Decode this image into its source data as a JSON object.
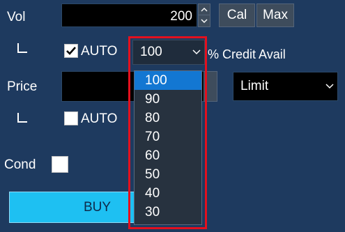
{
  "vol": {
    "label": "Vol",
    "value": "200",
    "cal_label": "Cal",
    "max_label": "Max",
    "auto_label": "AUTO",
    "auto_checked": true
  },
  "credit": {
    "selected": "100",
    "suffix_label": "% Credit Avail",
    "options": [
      "100",
      "90",
      "80",
      "70",
      "60",
      "50",
      "40",
      "30"
    ],
    "selected_index": 0
  },
  "price": {
    "label": "Price",
    "value": "",
    "order_type": "Limit",
    "auto_label": "AUTO",
    "auto_checked": false
  },
  "cond": {
    "label": "Cond",
    "checked": false
  },
  "buy": {
    "label": "BUY"
  },
  "colors": {
    "background": "#1e3a5f",
    "buy_button": "#1ec0f2",
    "selected_option": "#1377d2",
    "highlight_box": "#e3101e"
  }
}
